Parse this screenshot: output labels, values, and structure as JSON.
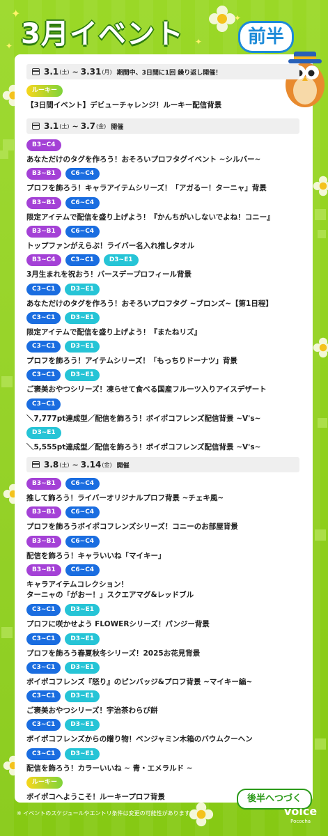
{
  "header": {
    "title": "3月イベント",
    "badge": "前半"
  },
  "sections": [
    {
      "date_start": "3.1",
      "dow_start": "(土)",
      "sep": "~",
      "date_end": "3.31",
      "dow_end": "(月)",
      "note": "期間中、3日間に1回 繰り返し開催！",
      "events": [
        {
          "tags": [
            {
              "label": "ルーキー",
              "kind": "rookie"
            }
          ],
          "name": "【3日間イベント】デビューチャレンジ！ルーキー配信背景"
        }
      ]
    },
    {
      "date_start": "3.1",
      "dow_start": "(土)",
      "sep": "~",
      "date_end": "3.7",
      "dow_end": "(金)",
      "note": "開催",
      "events": [
        {
          "tags": [
            {
              "label": "B3~C4",
              "kind": "purple"
            }
          ],
          "name": "あなただけのタグを作ろう！おそろいプロフタグイベント ~シルバー~"
        },
        {
          "tags": [
            {
              "label": "B3~B1",
              "kind": "purple"
            },
            {
              "label": "C6~C4",
              "kind": "blue"
            }
          ],
          "name": "プロフを飾ろう！キャラアイテムシリーズ！「アガるー！ターニャ」背景"
        },
        {
          "tags": [
            {
              "label": "B3~B1",
              "kind": "purple"
            },
            {
              "label": "C6~C4",
              "kind": "blue"
            }
          ],
          "name": "限定アイテムで配信を盛り上げよう！『かんちがいしないでよね！コニー』"
        },
        {
          "tags": [
            {
              "label": "B3~B1",
              "kind": "purple"
            },
            {
              "label": "C6~C4",
              "kind": "blue"
            }
          ],
          "name": "トップファンがえらぶ！ライバー名入れ推しタオル"
        },
        {
          "tags": [
            {
              "label": "B3~C4",
              "kind": "purple"
            },
            {
              "label": "C3~C1",
              "kind": "blue"
            },
            {
              "label": "D3~E1",
              "kind": "cyan"
            }
          ],
          "name": "3月生まれを祝おう！バースデープロフィール背景"
        },
        {
          "tags": [
            {
              "label": "C3~C1",
              "kind": "blue"
            },
            {
              "label": "D3~E1",
              "kind": "cyan"
            }
          ],
          "name": "あなただけのタグを作ろう！おそろいプロフタグ ~ブロンズ~【第1日程】"
        },
        {
          "tags": [
            {
              "label": "C3~C1",
              "kind": "blue"
            },
            {
              "label": "D3~E1",
              "kind": "cyan"
            }
          ],
          "name": "限定アイテムで配信を盛り上げよう！『またねリズ』"
        },
        {
          "tags": [
            {
              "label": "C3~C1",
              "kind": "blue"
            },
            {
              "label": "D3~E1",
              "kind": "cyan"
            }
          ],
          "name": "プロフを飾ろう！アイテムシリーズ！「もっちりドーナツ」背景"
        },
        {
          "tags": [
            {
              "label": "C3~C1",
              "kind": "blue"
            },
            {
              "label": "D3~E1",
              "kind": "cyan"
            }
          ],
          "name": "ご褒美おやつシリーズ！凍らせて食べる国産フルーツ入りアイスデザート"
        },
        {
          "tags": [
            {
              "label": "C3~C1",
              "kind": "blue"
            }
          ],
          "name": "＼7,777pt達成型／配信を飾ろう！ボイポコフレンズ配信背景 ~V's~"
        },
        {
          "tags": [
            {
              "label": "D3~E1",
              "kind": "cyan"
            }
          ],
          "name": "＼5,555pt達成型／配信を飾ろう！ボイポコフレンズ配信背景 ~V's~"
        }
      ]
    },
    {
      "date_start": "3.8",
      "dow_start": "(土)",
      "sep": "~",
      "date_end": "3.14",
      "dow_end": "(金)",
      "note": "開催",
      "events": [
        {
          "tags": [
            {
              "label": "B3~B1",
              "kind": "purple"
            },
            {
              "label": "C6~C4",
              "kind": "blue"
            }
          ],
          "name": "推して飾ろう！ライバーオリジナルプロフ背景 ~チェキ風~"
        },
        {
          "tags": [
            {
              "label": "B3~B1",
              "kind": "purple"
            },
            {
              "label": "C6~C4",
              "kind": "blue"
            }
          ],
          "name": "プロフを飾ろうボイポコフレンズシリーズ！コニーのお部屋背景"
        },
        {
          "tags": [
            {
              "label": "B3~B1",
              "kind": "purple"
            },
            {
              "label": "C6~C4",
              "kind": "blue"
            }
          ],
          "name": "配信を飾ろう！キャラいいね「マイキー」"
        },
        {
          "tags": [
            {
              "label": "B3~B1",
              "kind": "purple"
            },
            {
              "label": "C6~C4",
              "kind": "blue"
            }
          ],
          "name": "キャラアイテムコレクション！",
          "name2": "ターニャの「がおー！」スクエアマグ&レッドブル"
        },
        {
          "tags": [
            {
              "label": "C3~C1",
              "kind": "blue"
            },
            {
              "label": "D3~E1",
              "kind": "cyan"
            }
          ],
          "name": "プロフに咲かせよう FLOWERシリーズ！パンジー背景"
        },
        {
          "tags": [
            {
              "label": "C3~C1",
              "kind": "blue"
            },
            {
              "label": "D3~E1",
              "kind": "cyan"
            }
          ],
          "name": "プロフを飾ろう春夏秋冬シリーズ！2025お花見背景"
        },
        {
          "tags": [
            {
              "label": "C3~C1",
              "kind": "blue"
            },
            {
              "label": "D3~E1",
              "kind": "cyan"
            }
          ],
          "name": "ボイポコフレンズ『怒り』のピンバッジ&プロフ背景 ~マイキー編~"
        },
        {
          "tags": [
            {
              "label": "C3~C1",
              "kind": "blue"
            },
            {
              "label": "D3~E1",
              "kind": "cyan"
            }
          ],
          "name": "ご褒美おやつシリーズ！宇治茶わらび餅"
        },
        {
          "tags": [
            {
              "label": "C3~C1",
              "kind": "blue"
            },
            {
              "label": "D3~E1",
              "kind": "cyan"
            }
          ],
          "name": "ボイポコフレンズからの贈り物！ベンジャミン木箱のバウムクーヘン"
        },
        {
          "tags": [
            {
              "label": "C3~C1",
              "kind": "blue"
            },
            {
              "label": "D3~E1",
              "kind": "cyan"
            }
          ],
          "name": "配信を飾ろう！カラーいいね ~ 青・エメラルド ~"
        },
        {
          "tags": [
            {
              "label": "ルーキー",
              "kind": "rookie"
            }
          ],
          "name": "ボイポコへようこそ！ルーキープロフ背景"
        }
      ]
    }
  ],
  "footer": {
    "next_label": "後半へつづく",
    "note": "※ イベントのスケジュールやエントリ条件は変更の可能性があります。",
    "logo": "voice",
    "logo_sub": "Pococha"
  },
  "colors": {
    "background": "#8fd21a",
    "tag_purple": "#a441d6",
    "tag_blue": "#1a6de0",
    "tag_cyan": "#26c4d6"
  }
}
